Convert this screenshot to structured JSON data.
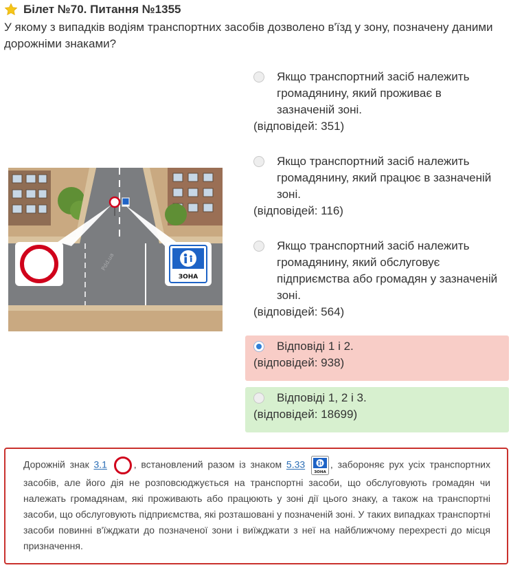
{
  "header": {
    "title": "Білет №70. Питання №1355",
    "question": "У якому з випадків водіям транспортних засобів дозволено в'їзд у зону, позначену даними дорожніми знаками?"
  },
  "illustration": {
    "sign_label": "ЗОНА",
    "watermark": "Pdd.ua"
  },
  "answers": [
    {
      "text": "Якщо транспортний засіб належить громадянину, який проживає в зазначеній зоні.",
      "count": "(відповідей: 351)",
      "state": "none"
    },
    {
      "text": "Якщо транспортний засіб належить громадянину, який працює в зазначеній зоні.",
      "count": "(відповідей: 116)",
      "state": "none"
    },
    {
      "text": "Якщо транспортний засіб належить громадянину, який обслуговує підприємства або громадян у зазначеній зоні.",
      "count": "(відповідей: 564)",
      "state": "none"
    },
    {
      "text": "Відповіді 1 і 2.",
      "count": "(відповідей: 938)",
      "state": "selected-wrong"
    },
    {
      "text": "Відповіді 1, 2 і 3.",
      "count": "(відповідей: 18699)",
      "state": "correct"
    }
  ],
  "explanation": {
    "part1": "Дорожній знак ",
    "link1": "3.1",
    "part2": ", встановлений разом із знаком ",
    "link2": "5.33",
    "part3": ", забороняє рух усіх транспортних засобів, але його дія не розповсюджується на транспортні засоби, що обслуговують громадян чи належать громадянам, які проживають або працюють у зоні дії цього знаку, а також на транспортні засоби, що обслуговують підприємства, які розташовані у позначеній зоні. У таких випадках транспортні засоби повинні в'їжджати до позначеної зони і виїжджати з неї на найближчому перехресті до місця призначення.",
    "sign_label": "ЗОНА"
  },
  "colors": {
    "wrong_bg": "#f8cdc7",
    "correct_bg": "#d7f0cf",
    "explain_border": "#c9302c",
    "star": "#f5c518",
    "link": "#2a6db5"
  }
}
